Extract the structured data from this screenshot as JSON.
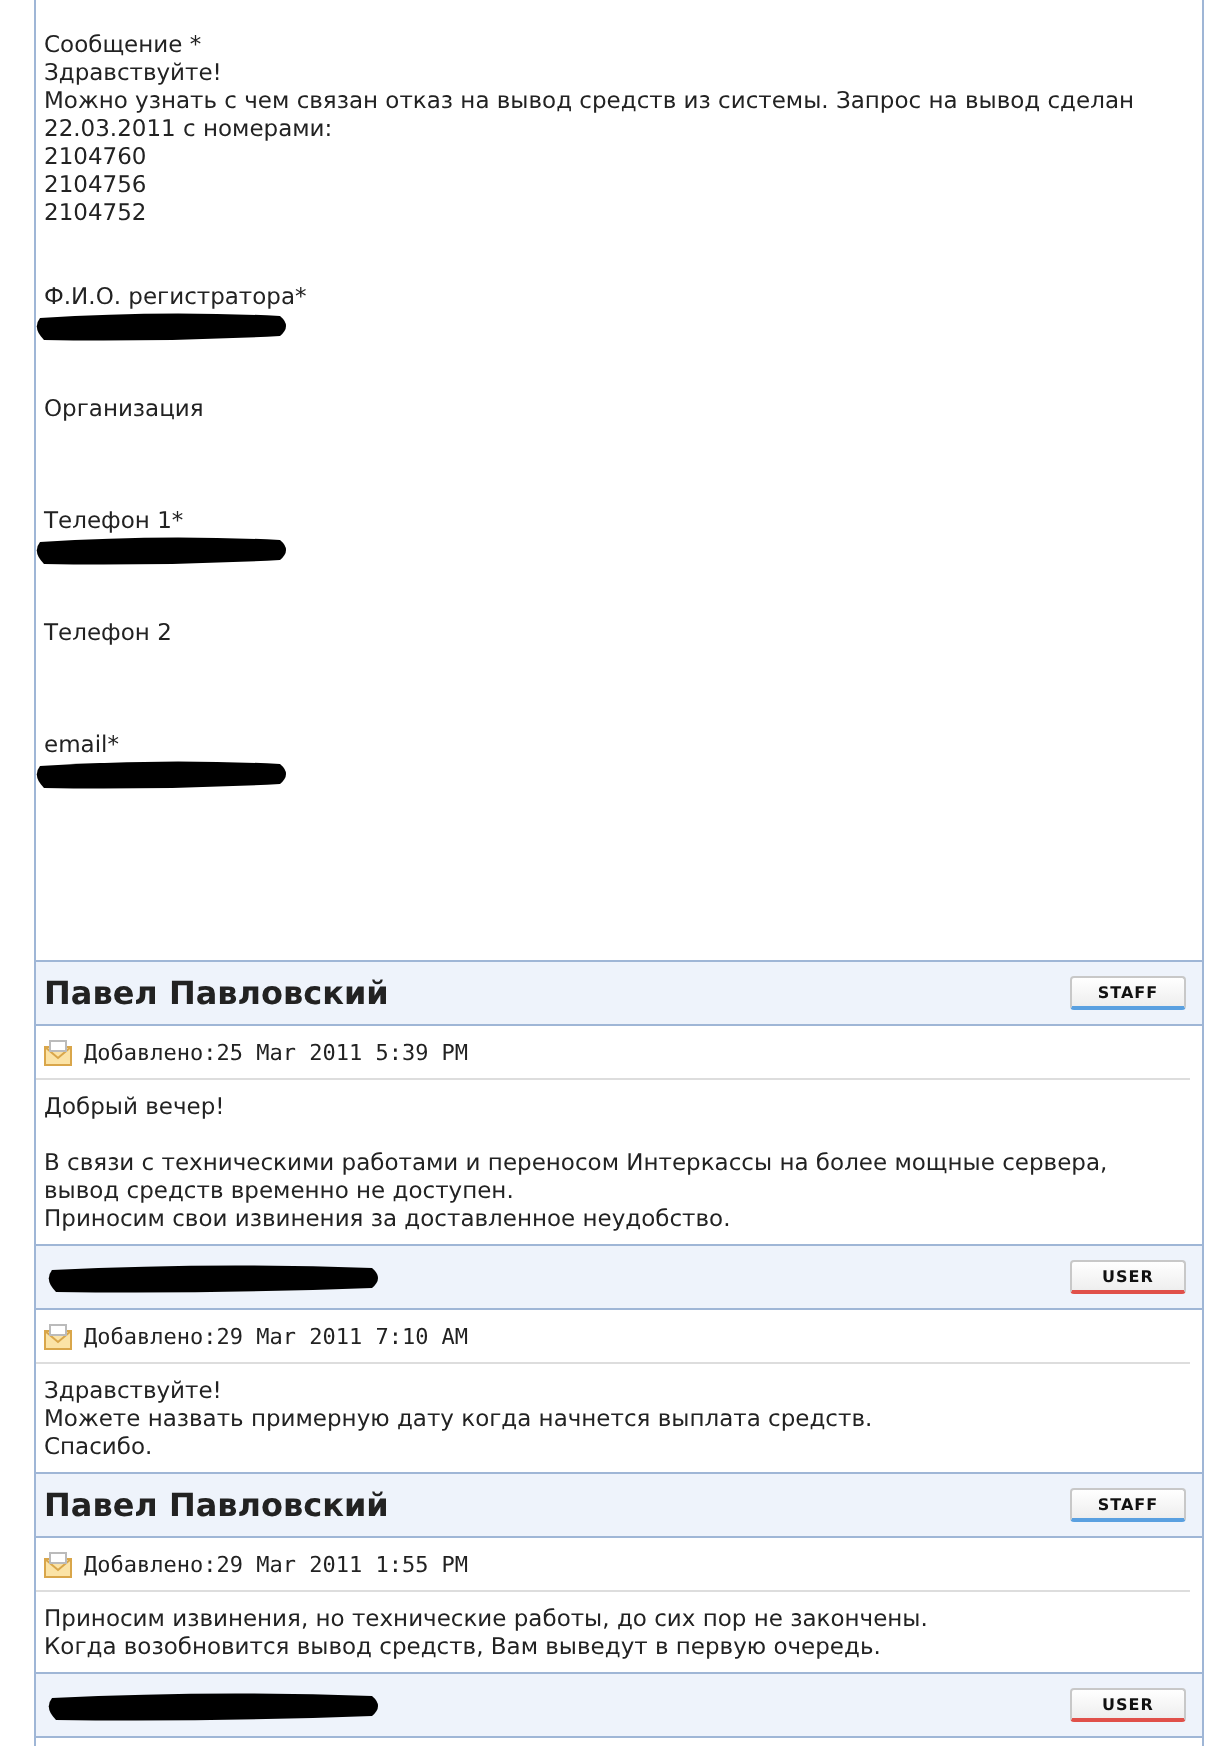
{
  "message": {
    "label": "Сообщение *",
    "text": "Здравствуйте!\nМожно узнать с чем связан отказ на вывод средств из системы. Запрос на вывод сделан\n22.03.2011 с номерами:\n2104760\n2104756\n2104752"
  },
  "fields": [
    {
      "label": "Ф.И.О. регистратора*",
      "redacted": true
    },
    {
      "label": "Организация",
      "redacted": false
    },
    {
      "label": "Телефон 1*",
      "redacted": true
    },
    {
      "label": "Телефон 2",
      "redacted": false
    },
    {
      "label": "email*",
      "redacted": true
    }
  ],
  "posts": [
    {
      "author": "Павел Павловский",
      "redacted": false,
      "kind": "staff",
      "role": "STAFF",
      "date": "Добавлено:25 Mar 2011 5:39 PM",
      "body": "Добрый вечер!\n\nВ связи с техническими работами и переносом Интеркассы на более мощные сервера,\nвывод средств временно не доступен.\nПриносим свои извинения за доставленное неудобство."
    },
    {
      "redacted": true,
      "kind": "user",
      "role": "USER",
      "date": "Добавлено:29 Mar 2011 7:10 AM",
      "body": "Здравствуйте!\nМожете назвать примерную дату когда начнется выплата средств.\nСпасибо."
    },
    {
      "author": "Павел Павловский",
      "redacted": false,
      "kind": "staff",
      "role": "STAFF",
      "date": "Добавлено:29 Mar 2011 1:55 PM",
      "body": "Приносим извинения, но технические работы, до сих пор не закончены.\nКогда возобновится вывод средств, Вам выведут в первую очередь."
    },
    {
      "redacted": true,
      "kind": "user",
      "role": "USER"
    }
  ]
}
